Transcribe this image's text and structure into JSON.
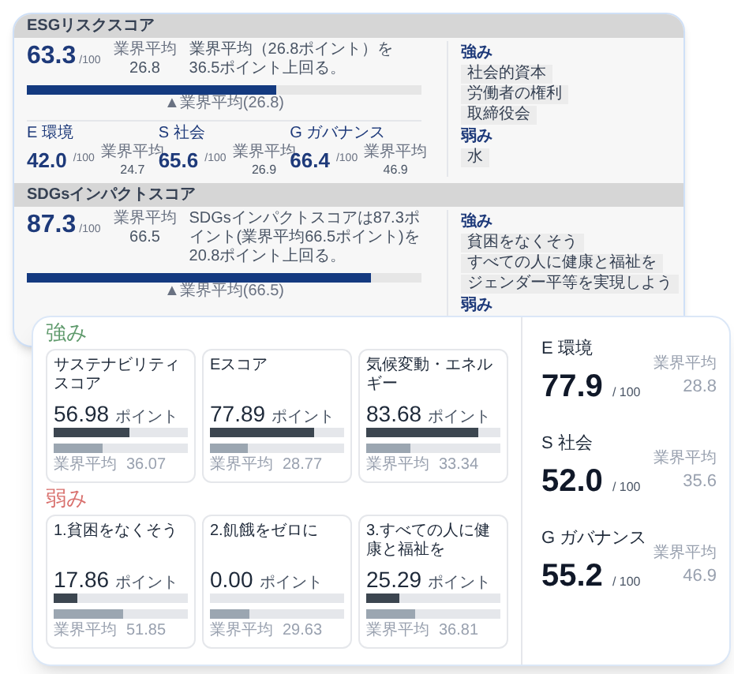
{
  "back_panel": {
    "sections": [
      {
        "title": "ESGリスクスコア",
        "score": {
          "value": "63.3",
          "unit": "/100",
          "average_label": "業界平均",
          "average_value": "26.8",
          "description": "業界平均（26.8ポイント）を36.5ポイント上回る。",
          "level": 0.633
        },
        "marker": {
          "label": "▲業界平均(26.8)"
        },
        "pillars": [
          {
            "label": "E 環境",
            "value": "42.0",
            "unit": "/100",
            "average_label": "業界平均",
            "average_value": "24.7"
          },
          {
            "label": "S 社会",
            "value": "65.6",
            "unit": "/100",
            "average_label": "業界平均",
            "average_value": "26.9"
          },
          {
            "label": "G ガバナンス",
            "value": "66.4",
            "unit": "/100",
            "average_label": "業界平均",
            "average_value": "46.9"
          }
        ],
        "strengths": {
          "heading": "強み",
          "items": [
            "社会的資本",
            "労働者の権利",
            "取締役会"
          ]
        },
        "weaknesses": {
          "heading": "弱み",
          "items": [
            "水"
          ]
        }
      },
      {
        "title": "SDGsインパクトスコア",
        "score": {
          "value": "87.3",
          "unit": "/100",
          "average_label": "業界平均",
          "average_value": "66.5",
          "description": "SDGsインパクトスコアは87.3ポイント(業界平均66.5ポイント)を20.8ポイント上回る。",
          "level": 0.873
        },
        "marker": {
          "label": "▲業界平均(66.5)"
        },
        "strengths": {
          "heading": "強み",
          "items": [
            "貧困をなくそう",
            "すべての人に健康と福祉を",
            "ジェンダー平等を実現しよう"
          ]
        },
        "weaknesses": {
          "heading": "弱み"
        }
      }
    ]
  },
  "front_card": {
    "groups": [
      {
        "kind": "strength",
        "heading": "強み",
        "cards": [
          {
            "title": "サステナビリティスコア",
            "score": {
              "value": "56.98",
              "unit": "ポイント",
              "level": 0.5698
            },
            "average": {
              "label": "業界平均",
              "value": "36.07",
              "level": 0.3607
            }
          },
          {
            "title": "Eスコア",
            "score": {
              "value": "77.89",
              "unit": "ポイント",
              "level": 0.7789
            },
            "average": {
              "label": "業界平均",
              "value": "28.77",
              "level": 0.2877
            }
          },
          {
            "title": "気候変動・エネルギー",
            "score": {
              "value": "83.68",
              "unit": "ポイント",
              "level": 0.8368
            },
            "average": {
              "label": "業界平均",
              "value": "33.34",
              "level": 0.3334
            }
          }
        ]
      },
      {
        "kind": "weakness",
        "heading": "弱み",
        "cards": [
          {
            "title": "1.貧困をなくそう",
            "score": {
              "value": "17.86",
              "unit": "ポイント",
              "level": 0.1786
            },
            "average": {
              "label": "業界平均",
              "value": "51.85",
              "level": 0.5185
            }
          },
          {
            "title": "2.飢餓をゼロに",
            "score": {
              "value": "0.00",
              "unit": "ポイント",
              "level": 0
            },
            "average": {
              "label": "業界平均",
              "value": "29.63",
              "level": 0.2963
            }
          },
          {
            "title": "3.すべての人に健康と福祉を",
            "score": {
              "value": "25.29",
              "unit": "ポイント",
              "level": 0.2529
            },
            "average": {
              "label": "業界平均",
              "value": "36.81",
              "level": 0.3681
            }
          }
        ]
      }
    ],
    "pillars": [
      {
        "label": "E 環境",
        "value": "77.9",
        "unit": "/ 100",
        "average_label": "業界平均",
        "average_value": "28.8"
      },
      {
        "label": "S 社会",
        "value": "52.0",
        "unit": "/ 100",
        "average_label": "業界平均",
        "average_value": "35.6"
      },
      {
        "label": "G ガバナンス",
        "value": "55.2",
        "unit": "/ 100",
        "average_label": "業界平均",
        "average_value": "46.9"
      }
    ]
  }
}
